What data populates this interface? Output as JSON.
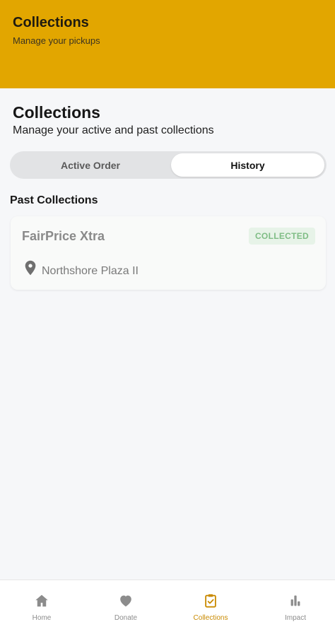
{
  "header": {
    "title": "Collections",
    "subtitle": "Manage your pickups"
  },
  "page": {
    "title": "Collections",
    "subtitle": "Manage your active and past collections"
  },
  "segmented": {
    "tabs": [
      {
        "label": "Active Order",
        "selected": false
      },
      {
        "label": "History",
        "selected": true
      }
    ]
  },
  "past_collections": {
    "title": "Past Collections",
    "items": [
      {
        "store": "FairPrice Xtra",
        "status": "COLLECTED",
        "location": "Northshore Plaza II",
        "location_icon": "map-pin-icon"
      }
    ]
  },
  "bottom_nav": {
    "items": [
      {
        "label": "Home",
        "icon": "home-icon",
        "active": false
      },
      {
        "label": "Donate",
        "icon": "heart-icon",
        "active": false
      },
      {
        "label": "Collections",
        "icon": "clipboard-check-icon",
        "active": true
      },
      {
        "label": "Impact",
        "icon": "bar-chart-icon",
        "active": false
      }
    ]
  },
  "colors": {
    "header_bg": "#e2a600",
    "accent": "#c98a00",
    "badge_bg": "#e7f3e8",
    "badge_text": "#7fbd85"
  }
}
